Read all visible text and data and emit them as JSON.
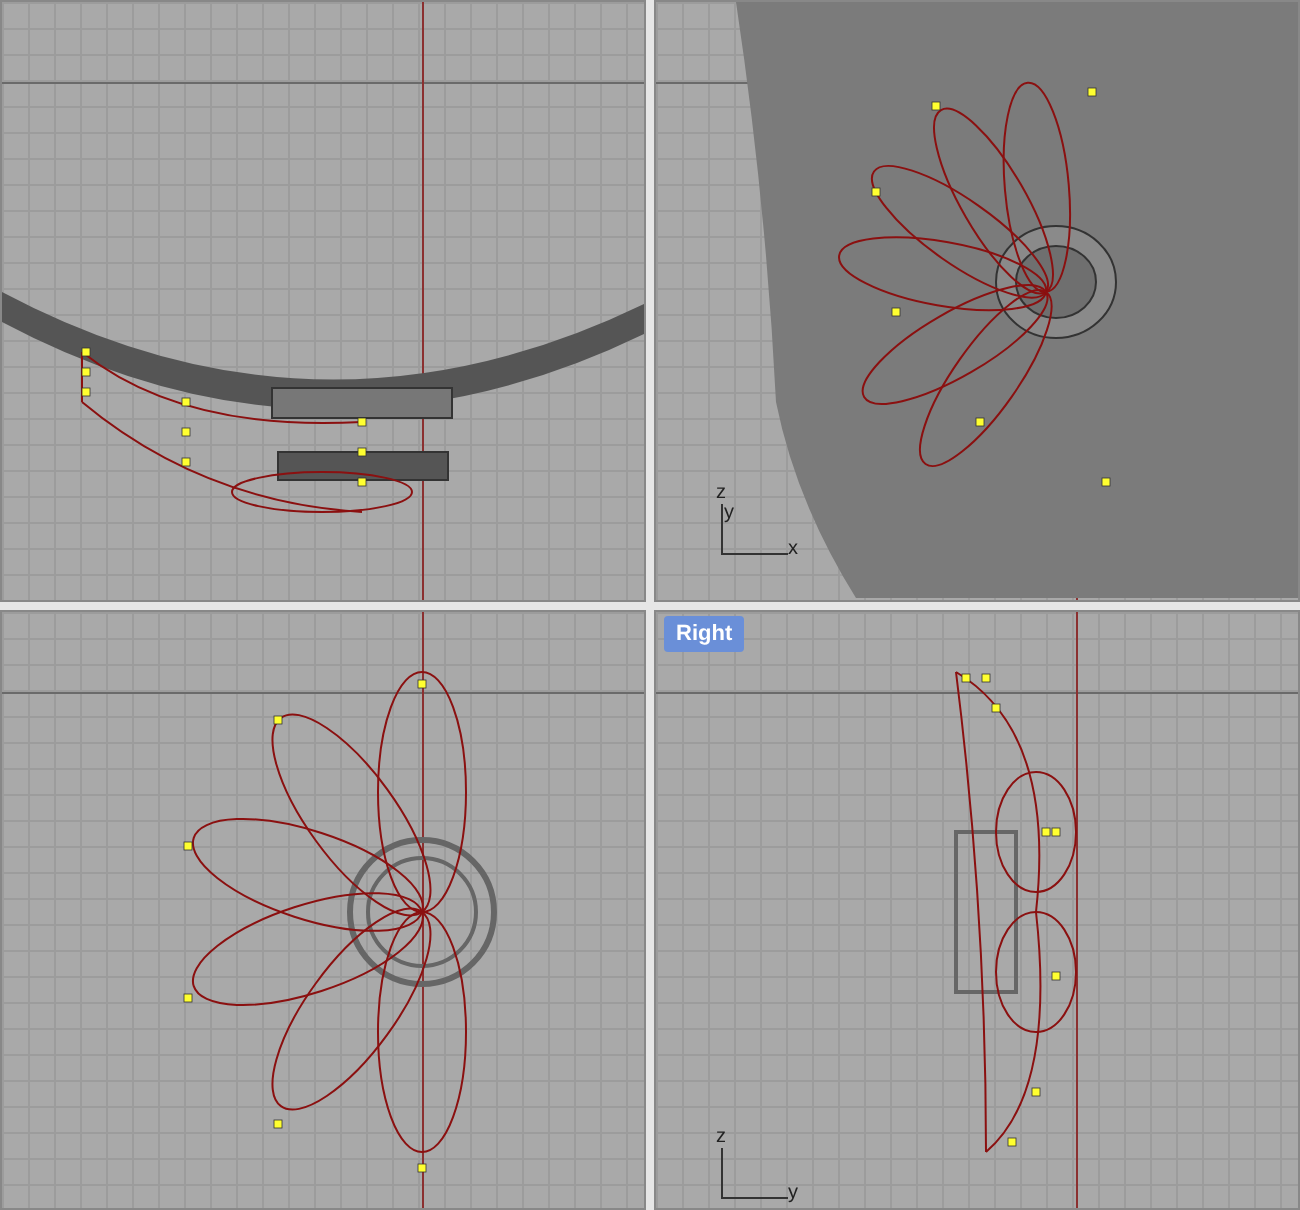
{
  "viewports": [
    {
      "kind": "top"
    },
    {
      "kind": "perspective",
      "axes": [
        "z",
        "y",
        "x"
      ]
    },
    {
      "kind": "front"
    },
    {
      "kind": "right",
      "title": "Right",
      "axes": [
        "z",
        "y"
      ]
    }
  ]
}
